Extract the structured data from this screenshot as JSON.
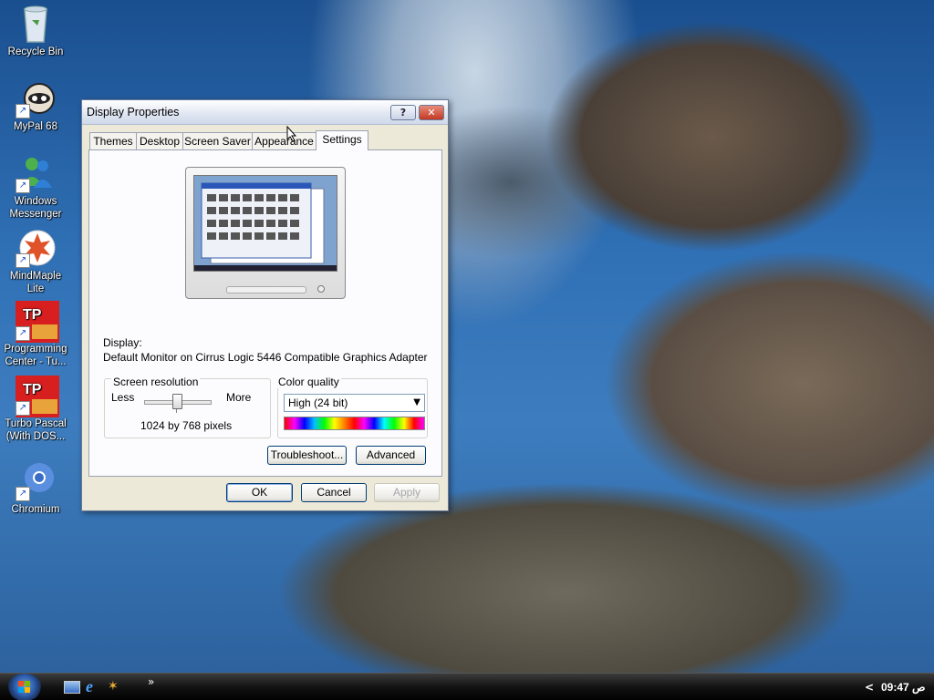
{
  "desktop": {
    "icons": [
      {
        "label": "Recycle Bin",
        "icon": "recycle-bin-icon"
      },
      {
        "label": "MyPal 68",
        "icon": "mypal-icon"
      },
      {
        "label": "Windows Messenger",
        "icon": "messenger-icon"
      },
      {
        "label": "MindMaple Lite",
        "icon": "mindmaple-icon"
      },
      {
        "label": "Programming Center - Tu...",
        "icon": "tp-icon"
      },
      {
        "label": "Turbo Pascal (With DOS...",
        "icon": "tp-icon"
      },
      {
        "label": "Chromium",
        "icon": "chromium-icon"
      }
    ]
  },
  "dialog": {
    "title": "Display Properties",
    "help_label": "?",
    "close_label": "✕",
    "tabs": [
      "Themes",
      "Desktop",
      "Screen Saver",
      "Appearance",
      "Settings"
    ],
    "active_tab": "Settings",
    "display_label": "Display:",
    "display_value": "Default Monitor on Cirrus Logic 5446 Compatible Graphics Adapter",
    "resolution": {
      "group_label": "Screen resolution",
      "less": "Less",
      "more": "More",
      "value_text": "1024 by 768 pixels"
    },
    "color_quality": {
      "group_label": "Color quality",
      "selected": "High (24 bit)"
    },
    "troubleshoot_label": "Troubleshoot...",
    "advanced_label": "Advanced",
    "ok_label": "OK",
    "cancel_label": "Cancel",
    "apply_label": "Apply"
  },
  "taskbar": {
    "clock": "09:47 ص",
    "expand_label": "»",
    "tray_arrow": "<"
  },
  "colors": {
    "accent": "#1a4fc0",
    "dialog_bg": "#ece9d8",
    "taskbar": "#000000"
  }
}
